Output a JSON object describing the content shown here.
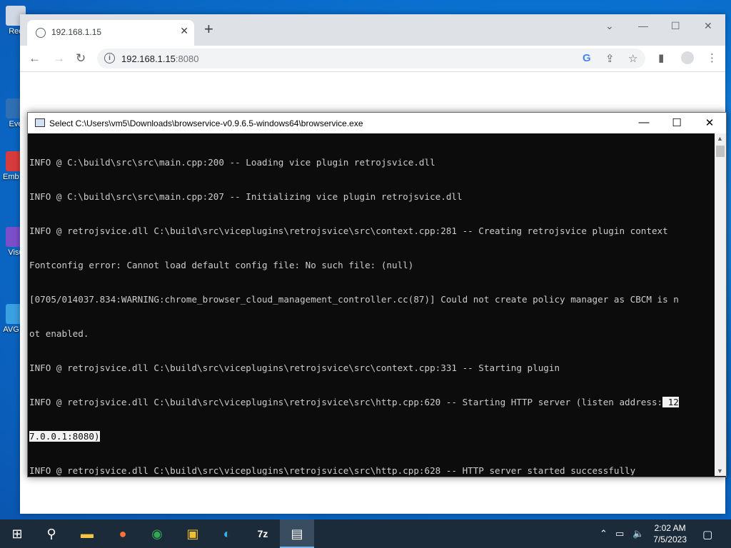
{
  "desktop": {
    "icons": [
      {
        "label": "Rec",
        "color": "#cfd8e3"
      },
      {
        "label": "Eve",
        "color": "#2f6fb3"
      },
      {
        "label": "Emb De",
        "color": "#d83b3b"
      },
      {
        "label": "Visu",
        "color": "#7b4fc9"
      },
      {
        "label": "AVG Bi",
        "color": "#3aa0e0"
      }
    ]
  },
  "browser": {
    "tab_title": "192.168.1.15",
    "tab_close": "✕",
    "new_tab": "+",
    "url_host": "192.168.1.15",
    "url_port": ":8080",
    "nav_back": "←",
    "nav_forward": "→",
    "nav_reload": "↻"
  },
  "console": {
    "title": "Select C:\\Users\\vm5\\Downloads\\browservice-v0.9.6.5-windows64\\browservice.exe",
    "lines": [
      "INFO @ C:\\build\\src\\src\\main.cpp:200 -- Loading vice plugin retrojsvice.dll",
      "INFO @ C:\\build\\src\\src\\main.cpp:207 -- Initializing vice plugin retrojsvice.dll",
      "INFO @ retrojsvice.dll C:\\build\\src\\viceplugins\\retrojsvice\\src\\context.cpp:281 -- Creating retrojsvice plugin context",
      "Fontconfig error: Cannot load default config file: No such file: (null)",
      "[0705/014037.834:WARNING:chrome_browser_cloud_management_controller.cc(87)] Could not create policy manager as CBCM is n",
      "ot enabled.",
      "INFO @ retrojsvice.dll C:\\build\\src\\viceplugins\\retrojsvice\\src\\context.cpp:331 -- Starting plugin",
      "INFO @ retrojsvice.dll C:\\build\\src\\viceplugins\\retrojsvice\\src\\http.cpp:620 -- Starting HTTP server (listen address:",
      "7.0.0.1:8080)",
      "INFO @ retrojsvice.dll C:\\build\\src\\viceplugins\\retrojsvice\\src\\http.cpp:628 -- HTTP server started successfully"
    ],
    "line8_selected_tail": " 12"
  },
  "taskbar": {
    "time": "2:02 AM",
    "date": "7/5/2023"
  }
}
